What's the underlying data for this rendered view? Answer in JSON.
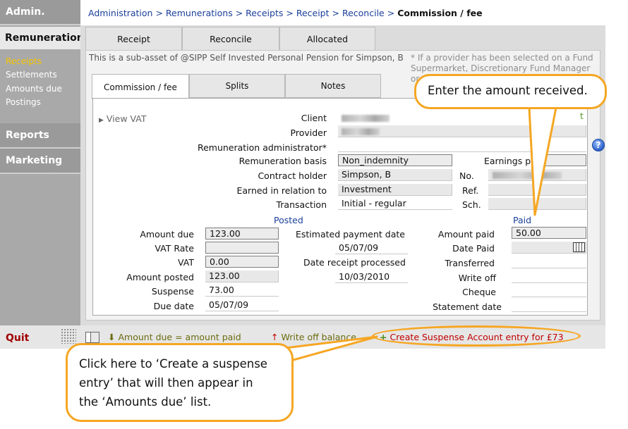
{
  "sidebar": {
    "admin": "Admin.",
    "remuneration": "Remuneration",
    "sub_items": [
      "Receipts",
      "Settlements",
      "Amounts due",
      "Postings"
    ],
    "reports": "Reports",
    "marketing": "Marketing",
    "quit": "Quit"
  },
  "breadcrumb": {
    "items": [
      "Administration",
      "Remunerations",
      "Receipts",
      "Receipt",
      "Reconcile"
    ],
    "separator": ">",
    "current": "Commission / fee"
  },
  "top_tabs": [
    "Receipt",
    "Reconcile",
    "Allocated"
  ],
  "sub_asset_text": "This is a sub-asset of @SIPP Self Invested Personal Pension for Simpson, B",
  "provider_note": "* If a provider has been selected on a Fund Supermarket, Discretionary Fund Manager or",
  "inner_tabs": [
    "Commission / fee",
    "Splits",
    "Notes"
  ],
  "form": {
    "view_vat": "View VAT",
    "client_label": "Client",
    "provider_label": "Provider",
    "admin_label": "Remuneration administrator*",
    "basis_label": "Remuneration basis",
    "basis_value": "Non_indemnity",
    "earnings_label": "Earnings p",
    "earnings_value": "",
    "holder_label": "Contract holder",
    "holder_value": "Simpson, B",
    "no_label": "No.",
    "earned_label": "Earned in relation to",
    "earned_value": "Investment",
    "ref_label": "Ref.",
    "transaction_label": "Transaction",
    "transaction_value": "Initial - regular",
    "sch_label": "Sch.",
    "posted_header": "Posted",
    "paid_header": "Paid",
    "amount_due_label": "Amount due",
    "amount_due_value": "123.00",
    "vat_rate_label": "VAT Rate",
    "vat_label": "VAT",
    "vat_value": "0.00",
    "amount_posted_label": "Amount posted",
    "amount_posted_value": "123.00",
    "suspense_label": "Suspense",
    "suspense_value": "73.00",
    "due_date_label": "Due date",
    "due_date_value": "05/07/09",
    "est_payment_label": "Estimated payment date",
    "est_payment_value": "05/07/09",
    "date_receipt_label": "Date receipt processed",
    "date_receipt_value": "10/03/2010",
    "amount_paid_label": "Amount paid",
    "amount_paid_value": "50.00",
    "date_paid_label": "Date Paid",
    "transferred_label": "Transferred",
    "write_off_label": "Write off",
    "cheque_label": "Cheque",
    "statement_label": "Statement date",
    "edge_text": "t"
  },
  "bottom_bar": {
    "amount_due_paid": "Amount due = amount paid",
    "write_off_balance": "Write off balance",
    "create_suspense": "Create Suspense Account entry for £73",
    "arrow_down": "⬇",
    "arrow_up": "↑",
    "plus": "+"
  },
  "callouts": {
    "enter_amount": "Enter the amount received.",
    "suspense_lines": [
      "Click here to ‘Create a suspense",
      "entry’ that will then appear in",
      "the ‘Amounts due’ list."
    ]
  },
  "help_symbol": "?",
  "colors": {
    "link": "#1a3f9a",
    "accent_gold": "#f5c400",
    "quit_red": "#a00000",
    "callout_border": "#f5a623"
  }
}
